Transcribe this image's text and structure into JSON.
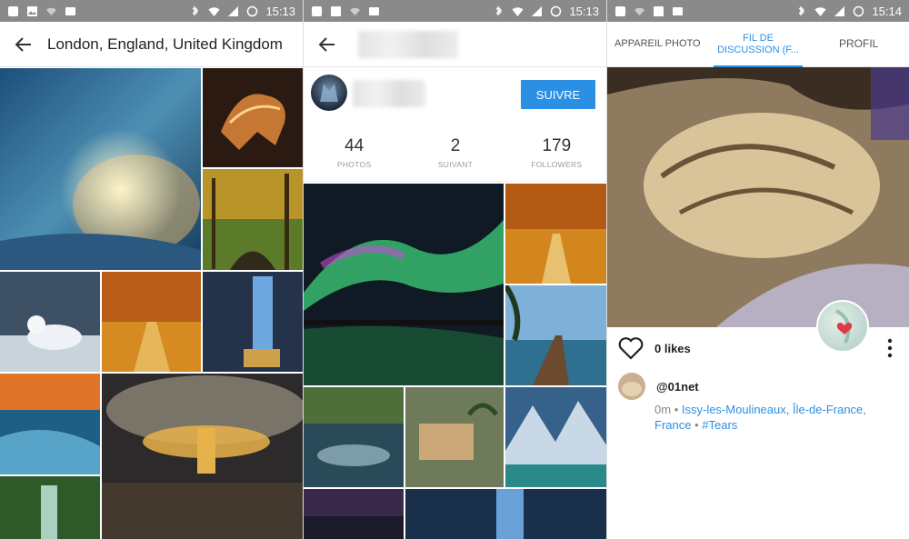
{
  "colors": {
    "accent": "#2b8fe4",
    "statusbar": "#8a8a8a"
  },
  "screens": [
    {
      "status": {
        "time": "15:13",
        "network": "4G"
      },
      "appbar": {
        "back_icon": "arrow-left-icon",
        "title": "London, England, United Kingdom"
      }
    },
    {
      "status": {
        "time": "15:13",
        "network": "4G"
      },
      "appbar": {
        "back_icon": "arrow-left-icon"
      },
      "profile": {
        "follow_label": "SUIVRE",
        "stats": [
          {
            "value": "44",
            "label": "PHOTOS"
          },
          {
            "value": "2",
            "label": "SUIVANT"
          },
          {
            "value": "179",
            "label": "FOLLOWERS"
          }
        ]
      }
    },
    {
      "status": {
        "time": "15:14",
        "network": "4G"
      },
      "tabs": [
        "APPAREIL PHOTO",
        "FIL DE DISCUSSION (F...",
        "PROFIL"
      ],
      "post": {
        "likes": "0 likes",
        "author": "@01net",
        "time": "0m",
        "location": "Issy-les-Moulineaux, Île-de-France, France",
        "tag": "#Tears",
        "separator": "•",
        "heart_icon": "heart-outline-icon",
        "more_icon": "more-vertical-icon"
      }
    }
  ]
}
